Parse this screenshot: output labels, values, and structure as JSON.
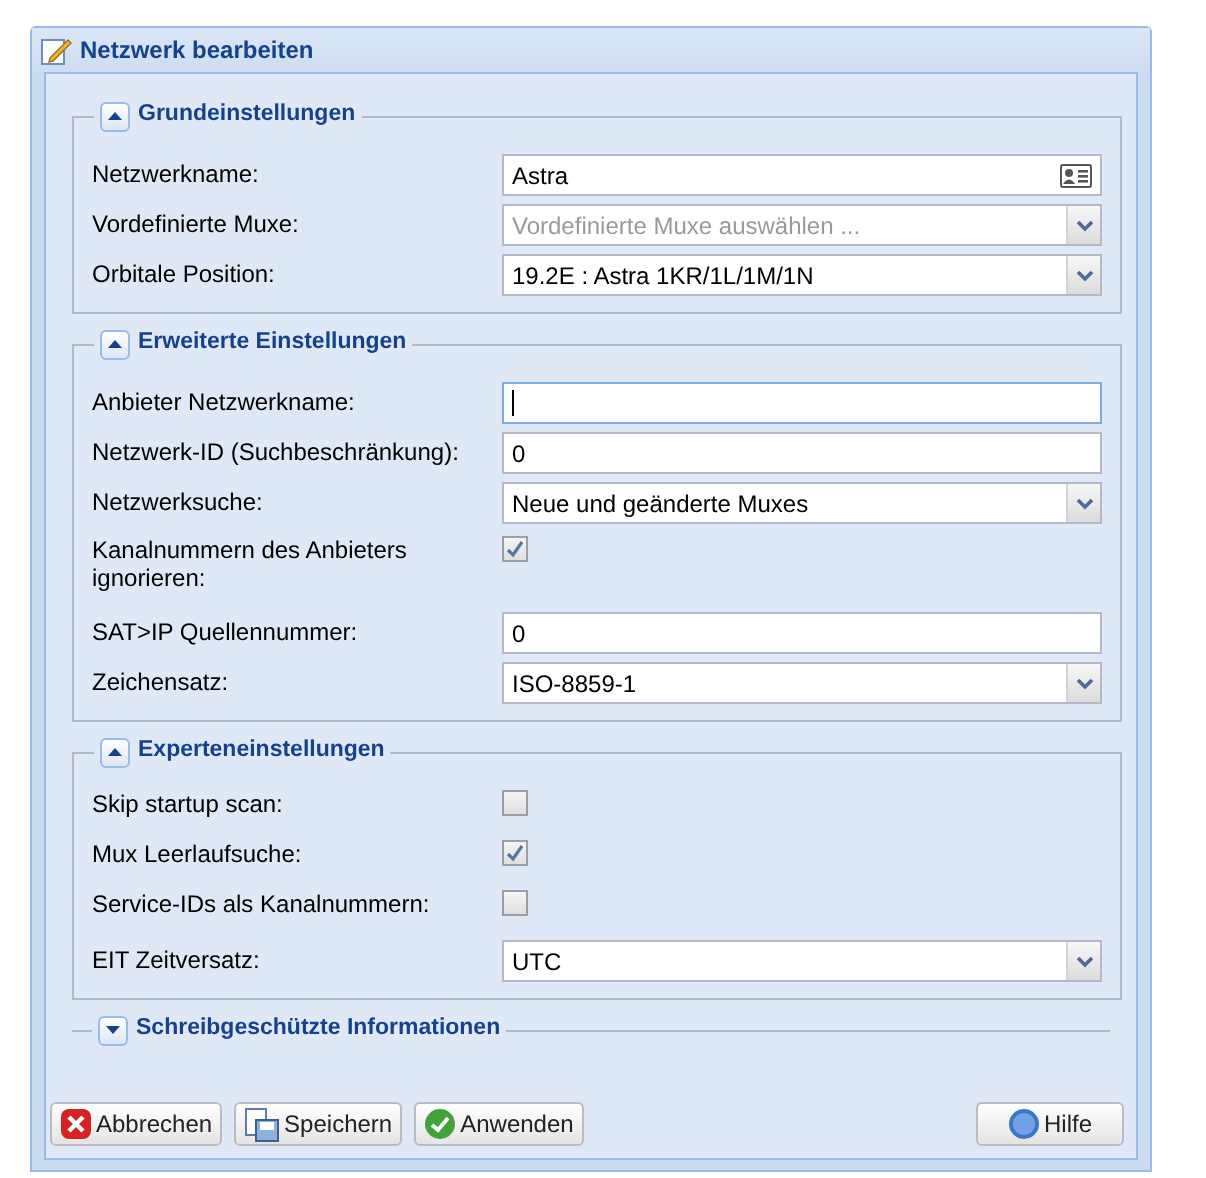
{
  "window": {
    "title": "Netzwerk bearbeiten"
  },
  "sections": [
    {
      "title": "Grundeinstellungen",
      "expanded": true,
      "fields": [
        {
          "label": "Netzwerkname:",
          "kind": "textcard",
          "value": "Astra"
        },
        {
          "label": "Vordefinierte Muxe:",
          "kind": "combo",
          "placeholder": "Vordefinierte Muxe auswählen ..."
        },
        {
          "label": "Orbitale Position:",
          "kind": "combo",
          "value": "19.2E : Astra 1KR/1L/1M/1N"
        }
      ]
    },
    {
      "title": "Erweiterte Einstellungen",
      "expanded": true,
      "fields": [
        {
          "label": "Anbieter Netzwerkname:",
          "kind": "text",
          "focused": true
        },
        {
          "label": "Netzwerk-ID (Suchbeschränkung):",
          "kind": "text",
          "value": "0",
          "focused": false
        },
        {
          "label": "Netzwerksuche:",
          "kind": "combo",
          "value": "Neue und geänderte Muxes"
        },
        {
          "label": "Kanalnummern des Anbieters ignorieren:",
          "kind": "checkbox",
          "checked": true
        },
        {
          "label": "SAT>IP Quellennummer:",
          "kind": "text",
          "value": "0",
          "focused": false
        },
        {
          "label": "Zeichensatz:",
          "kind": "combo",
          "value": "ISO-8859-1"
        }
      ]
    },
    {
      "title": "Experteneinstellungen",
      "expanded": true,
      "fields": [
        {
          "label": "Skip startup scan:",
          "kind": "checkbox",
          "checked": false
        },
        {
          "label": "Mux Leerlaufsuche:",
          "kind": "checkbox",
          "checked": true
        },
        {
          "label": "Service-IDs als Kanalnummern:",
          "kind": "checkbox",
          "checked": false
        },
        {
          "label": "EIT Zeitversatz:",
          "kind": "combo",
          "value": "UTC"
        }
      ]
    },
    {
      "title": "Schreibgeschützte Informationen",
      "expanded": false
    }
  ],
  "buttons": [
    {
      "label": "Abbrechen",
      "kind": "cancel"
    },
    {
      "label": "Speichern",
      "kind": "save"
    },
    {
      "label": "Anwenden",
      "kind": "apply"
    },
    {
      "label": "Hilfe",
      "kind": "help"
    }
  ]
}
